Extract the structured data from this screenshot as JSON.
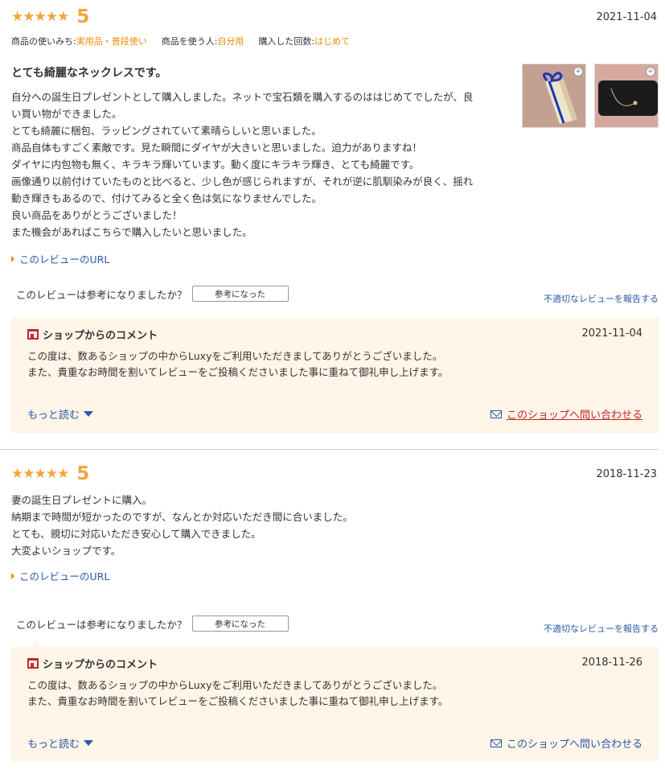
{
  "reviews": [
    {
      "stars": "★★★★★",
      "score": "5",
      "date": "2021-11-04",
      "meta": {
        "usage_label": "商品の使いみち:",
        "usage_value": "実用品・普段使い",
        "user_label": "商品を使う人:",
        "user_value": "自分用",
        "count_label": "購入した回数:",
        "count_value": "はじめて"
      },
      "title": "とても綺麗なネックレスです。",
      "body": [
        "自分への誕生日プレゼントとして購入しました。ネットで宝石類を購入するのははじめてでしたが、良",
        "い買い物ができました。",
        "とても綺麗に梱包、ラッピングされていて素晴らしいと思いました。",
        "商品自体もすごく素敵です。見た瞬間にダイヤが大きいと思いました。迫力がありますね！",
        "ダイヤに内包物も無く、キラキラ輝いています。動く度にキラキラ輝き、とても綺麗です。",
        "画像通り以前付けていたものと比べると、少し色が感じられますが、それが逆に肌馴染みが良く、揺れ",
        "動き輝きもあるので、付けてみると全く色は気になりませんでした。",
        "良い商品をありがとうございました！",
        "また機会があればこちらで購入したいと思いました。"
      ],
      "url_link": "このレビューのURL",
      "helpful_question": "このレビューは参考になりましたか？",
      "helpful_button": "参考になった",
      "report_link": "不適切なレビューを報告する",
      "shop": {
        "heading": "ショップからのコメント",
        "date": "2021-11-04",
        "lines": [
          "この度は、数あるショップの中からLuxyをご利用いただきましてありがとうございました。",
          "また、貴重なお時間を割いてレビューをご投稿くださいました事に重ねて御礼申し上げます。"
        ],
        "more": "もっと読む",
        "contact": "このショップへ問い合わせる"
      }
    },
    {
      "stars": "★★★★★",
      "score": "5",
      "date": "2018-11-23",
      "body": [
        "妻の誕生日プレゼントに購入。",
        "納期まで時間が短かったのですが、なんとか対応いただき間に合いました。",
        "とても、親切に対応いただき安心して購入できました。",
        "大変よいショップです。"
      ],
      "url_link": "このレビューのURL",
      "helpful_question": "このレビューは参考になりましたか？",
      "helpful_button": "参考になった",
      "report_link": "不適切なレビューを報告する",
      "shop": {
        "heading": "ショップからのコメント",
        "date": "2018-11-26",
        "lines": [
          "この度は、数あるショップの中からLuxyをご利用いただきましてありがとうございました。",
          "また、貴重なお時間を割いてレビューをご投稿くださいました事に重ねて御礼申し上げます。"
        ],
        "more": "もっと読む",
        "contact": "このショップへ問い合わせる"
      }
    }
  ],
  "icons": {
    "star": "star-icon",
    "shop": "shop-icon",
    "mail": "mail-icon",
    "zoom": "zoom-icon",
    "caret": "caret-down-icon"
  },
  "colors": {
    "star": "#f3a53a",
    "meta_value": "#f08a00",
    "link": "#2b58a8",
    "shop_box_bg": "#fff5e8",
    "contact_red": "#c0282d"
  }
}
